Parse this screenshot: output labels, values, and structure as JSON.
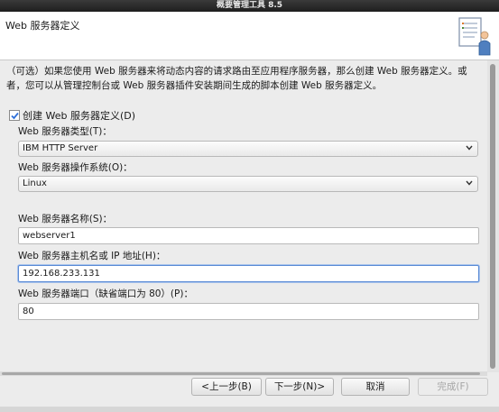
{
  "window": {
    "title": "概要管理工具 8.5"
  },
  "header": {
    "title": "Web 服务器定义",
    "icon": "wizard-document-icon"
  },
  "description": "（可选）如果您使用 Web 服务器来将动态内容的请求路由至应用程序服务器，那么创建 Web 服务器定义。或者，您可以从管理控制台或 Web 服务器插件安装期间生成的脚本创建 Web 服务器定义。",
  "create_checkbox": {
    "label": "创建 Web 服务器定义(D)",
    "checked": true
  },
  "server_type": {
    "label": "Web 服务器类型(T)：",
    "value": "IBM HTTP Server"
  },
  "server_os": {
    "label": "Web 服务器操作系统(O)：",
    "value": "Linux"
  },
  "server_name": {
    "label": "Web 服务器名称(S)：",
    "value": "webserver1"
  },
  "server_host": {
    "label": "Web 服务器主机名或 IP 地址(H)：",
    "value": "192.168.233.131"
  },
  "server_port": {
    "label": "Web 服务器端口（缺省端口为 80）(P)：",
    "value": "80"
  },
  "buttons": {
    "back": "<上一步(B)",
    "next": "下一步(N)>",
    "cancel": "取消",
    "finish": "完成(F)"
  },
  "colors": {
    "accent": "#5a8ad5",
    "check": "#2e6fd8"
  }
}
